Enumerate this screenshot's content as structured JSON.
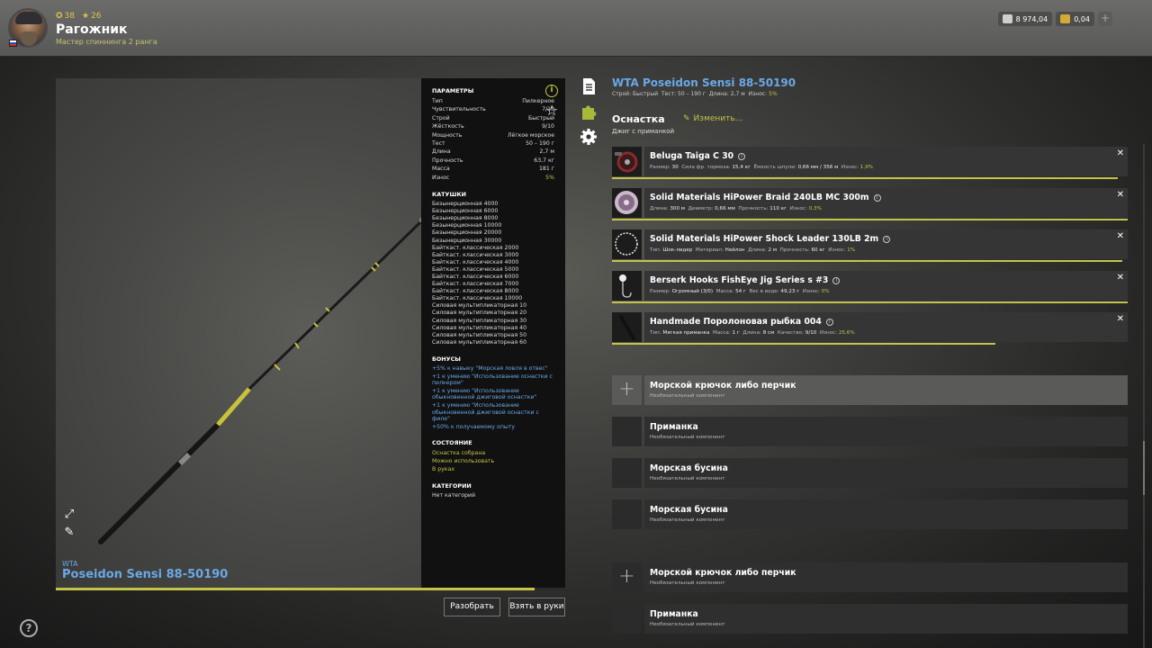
{
  "player": {
    "level": "38",
    "stars": "26",
    "name": "Рагожник",
    "rank": "Мастер спиннинга 2 ранга"
  },
  "wallet": {
    "silver": "8 974,04",
    "gold": "0,04",
    "add": "+"
  },
  "preview": {
    "brand": "WTA",
    "name": "Poseidon Sensi 88-50190",
    "progress": 0.94
  },
  "params": {
    "title": "ПАРАМЕТРЫ",
    "rows": [
      {
        "k": "Тип",
        "v": "Пилкерное"
      },
      {
        "k": "Чувствительность",
        "v": "7/10"
      },
      {
        "k": "Строй",
        "v": "Быстрый"
      },
      {
        "k": "Жёсткость",
        "v": "9/10"
      },
      {
        "k": "Мощность",
        "v": "Лёгкое морское"
      },
      {
        "k": "Тест",
        "v": "50 – 190 г"
      },
      {
        "k": "Длина",
        "v": "2,7 м"
      },
      {
        "k": "Прочность",
        "v": "63,7 кг"
      },
      {
        "k": "Масса",
        "v": "181 г"
      },
      {
        "k": "Износ",
        "v": "5%"
      }
    ],
    "reels_title": "КАТУШКИ",
    "reels": [
      "Безынерционная 4000",
      "Безынерционная 6000",
      "Безынерционная 8000",
      "Безынерционная 10000",
      "Безынерционная 20000",
      "Безынерционная 30000",
      "Байткаст. классическая 2000",
      "Байткаст. классическая 3000",
      "Байткаст. классическая 4000",
      "Байткаст. классическая 5000",
      "Байткаст. классическая 6000",
      "Байткаст. классическая 7000",
      "Байткаст. классическая 8000",
      "Байткаст. классическая 10000",
      "Силовая мультипликаторная 10",
      "Силовая мультипликаторная 20",
      "Силовая мультипликаторная 30",
      "Силовая мультипликаторная 40",
      "Силовая мультипликаторная 50",
      "Силовая мультипликаторная 60"
    ],
    "bonus_title": "БОНУСЫ",
    "bonuses": [
      "+5% к навыку \"Морская ловля в отвес\"",
      "+1 к умению \"Использование оснастки с пилкером\"",
      "+1 к умению \"Использование обыкновенной джиговой оснастки\"",
      "+1 к умению \"Использование обыкновенной джиговой оснастки с филе\"",
      "+50% к получаемому опыту"
    ],
    "state_title": "СОСТОЯНИЕ",
    "states": [
      "Оснастка собрана",
      "Можно использовать",
      "В руках"
    ],
    "cat_title": "КАТЕГОРИИ",
    "categories": "Нет категорий"
  },
  "actions": {
    "disassemble": "Разобрать",
    "take": "Взять в руки"
  },
  "rig": {
    "title": "WTA Poseidon Sensi 88-50190",
    "meta_build_label": "Строй:",
    "meta_build": "Быстрый",
    "meta_test_label": "Тест:",
    "meta_test": "50 – 190 г",
    "meta_len_label": "Длина:",
    "meta_len": "2,7 м",
    "meta_wear_label": "Износ:",
    "meta_wear": "5%",
    "tackle_header": "Оснастка",
    "edit": "Изменить...",
    "tackle_type": "Джиг с приманкой"
  },
  "items": [
    {
      "name": "Beluga Taiga C 30",
      "specs": [
        [
          "Размер:",
          "30"
        ],
        [
          "Сила фр. тормоза:",
          "15,4 кг"
        ],
        [
          "Ёмкость шпули:",
          "0,66 мм / 356 м"
        ],
        [
          "Износ:",
          "1,9%"
        ]
      ],
      "wear": 0.98
    },
    {
      "name": "Solid Materials HiPower Braid 240LB MC 300m",
      "specs": [
        [
          "Длина:",
          "300 м"
        ],
        [
          "Диаметр:",
          "0,66 мм"
        ],
        [
          "Прочность:",
          "110 кг"
        ],
        [
          "Износ:",
          "0,3%"
        ]
      ],
      "wear": 1.0
    },
    {
      "name": "Solid Materials HiPower Shock Leader 130LB 2m",
      "specs": [
        [
          "Тип:",
          "Шок-лидер"
        ],
        [
          "Материал:",
          "Нейлон"
        ],
        [
          "Длина:",
          "2 м"
        ],
        [
          "Прочность:",
          "60 кг"
        ],
        [
          "Износ:",
          "1%"
        ]
      ],
      "wear": 0.99
    },
    {
      "name": "Berserk Hooks FishEye Jig Series s #3",
      "specs": [
        [
          "Размер:",
          "Огромный (3/0)"
        ],
        [
          "Масса:",
          "54 г"
        ],
        [
          "Вес в воде:",
          "49,23 г"
        ],
        [
          "Износ:",
          "0%"
        ]
      ],
      "wear": 1.0
    },
    {
      "name": "Handmade Поролоновая рыбка 004",
      "specs": [
        [
          "Тип:",
          "Мягкая приманка"
        ],
        [
          "Масса:",
          "1 г"
        ],
        [
          "Длина:",
          "8 см"
        ],
        [
          "Качество:",
          "9/10"
        ],
        [
          "Износ:",
          "25,6%"
        ]
      ],
      "wear": 0.744
    }
  ],
  "slots": [
    {
      "label": "Морской крючок либо перчик",
      "note": "Необязательный компонент",
      "plus": true
    },
    {
      "label": "Приманка",
      "note": "Необязательный компонент",
      "plus": false
    },
    {
      "label": "Морская бусина",
      "note": "Необязательный компонент",
      "plus": false
    },
    {
      "label": "Морская бусина",
      "note": "Необязательный компонент",
      "plus": false
    },
    {
      "label": "Морской крючок либо перчик",
      "note": "Необязательный компонент",
      "plus": true
    },
    {
      "label": "Приманка",
      "note": "Необязательный компонент",
      "plus": false
    }
  ],
  "help": "?",
  "colors": {
    "accent_yellow": "#c5c44a",
    "link_blue": "#6aa8e6"
  }
}
